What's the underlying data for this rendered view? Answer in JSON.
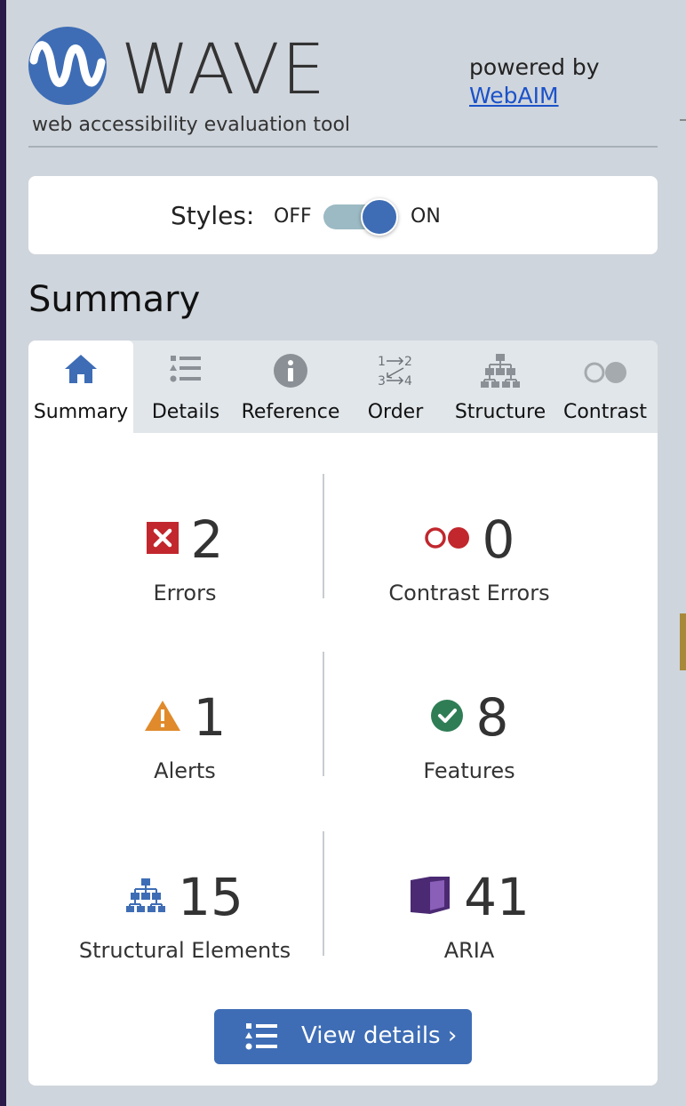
{
  "header": {
    "logo_word": "WAVE",
    "tagline": "web accessibility evaluation tool",
    "powered_by": "powered by",
    "webaim_link": "WebAIM"
  },
  "styles_toggle": {
    "label": "Styles:",
    "off_label": "OFF",
    "on_label": "ON",
    "state": "on"
  },
  "section_title": "Summary",
  "tabs": [
    {
      "label": "Summary",
      "icon": "home-icon",
      "active": true
    },
    {
      "label": "Details",
      "icon": "list-icon",
      "active": false
    },
    {
      "label": "Reference",
      "icon": "info-icon",
      "active": false
    },
    {
      "label": "Order",
      "icon": "order-icon",
      "active": false
    },
    {
      "label": "Structure",
      "icon": "structure-icon",
      "active": false
    },
    {
      "label": "Contrast",
      "icon": "contrast-icon",
      "active": false
    }
  ],
  "stats": {
    "errors": {
      "count": "2",
      "label": "Errors",
      "icon": "error-icon"
    },
    "contrast_errors": {
      "count": "0",
      "label": "Contrast Errors",
      "icon": "contrast-error-icon"
    },
    "alerts": {
      "count": "1",
      "label": "Alerts",
      "icon": "alert-icon"
    },
    "features": {
      "count": "8",
      "label": "Features",
      "icon": "feature-icon"
    },
    "structural": {
      "count": "15",
      "label": "Structural Elements",
      "icon": "structure-icon"
    },
    "aria": {
      "count": "41",
      "label": "ARIA",
      "icon": "aria-icon"
    }
  },
  "view_details_button": "View details ›",
  "colors": {
    "brand_blue": "#3e6db5",
    "error_red": "#c1272d",
    "alert_orange": "#e08a2c",
    "feature_green": "#2f7d55",
    "aria_purple": "#4b2a73",
    "link_blue": "#1b52c9"
  }
}
